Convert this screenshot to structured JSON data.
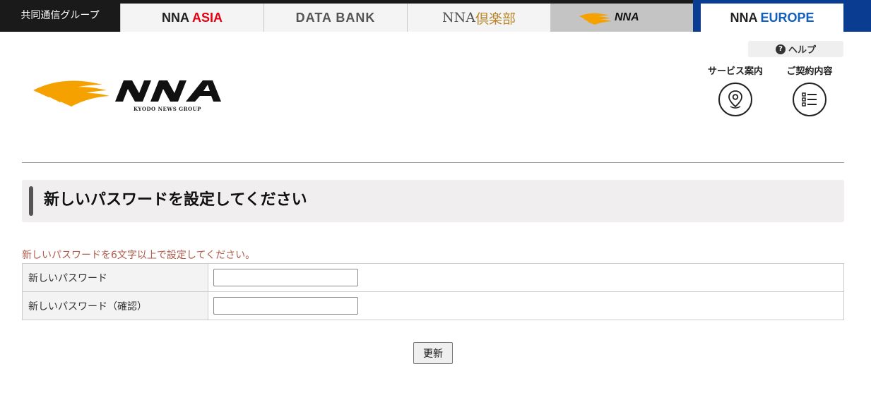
{
  "topbar": {
    "group_label": "共同通信グループ",
    "tabs": {
      "asia": {
        "main": "NNA",
        "accent": "ASIA"
      },
      "databank": "DATA BANK",
      "club": {
        "main": "NNA",
        "accent": "倶楽部"
      },
      "europe": {
        "main": "NNA",
        "accent": "EUROPE"
      }
    }
  },
  "header": {
    "help_label": "ヘルプ",
    "service_label": "サービス案内",
    "contract_label": "ご契約内容"
  },
  "main": {
    "title": "新しいパスワードを設定してください",
    "notice": "新しいパスワードを6文字以上で設定してください。",
    "fields": [
      {
        "label": "新しいパスワード",
        "value": ""
      },
      {
        "label": "新しいパスワード（確認）",
        "value": ""
      }
    ],
    "submit_label": "更新"
  },
  "colors": {
    "logo_orange": "#f5a100",
    "europe_blue": "#0a3d91",
    "notice": "#b05a4a"
  }
}
